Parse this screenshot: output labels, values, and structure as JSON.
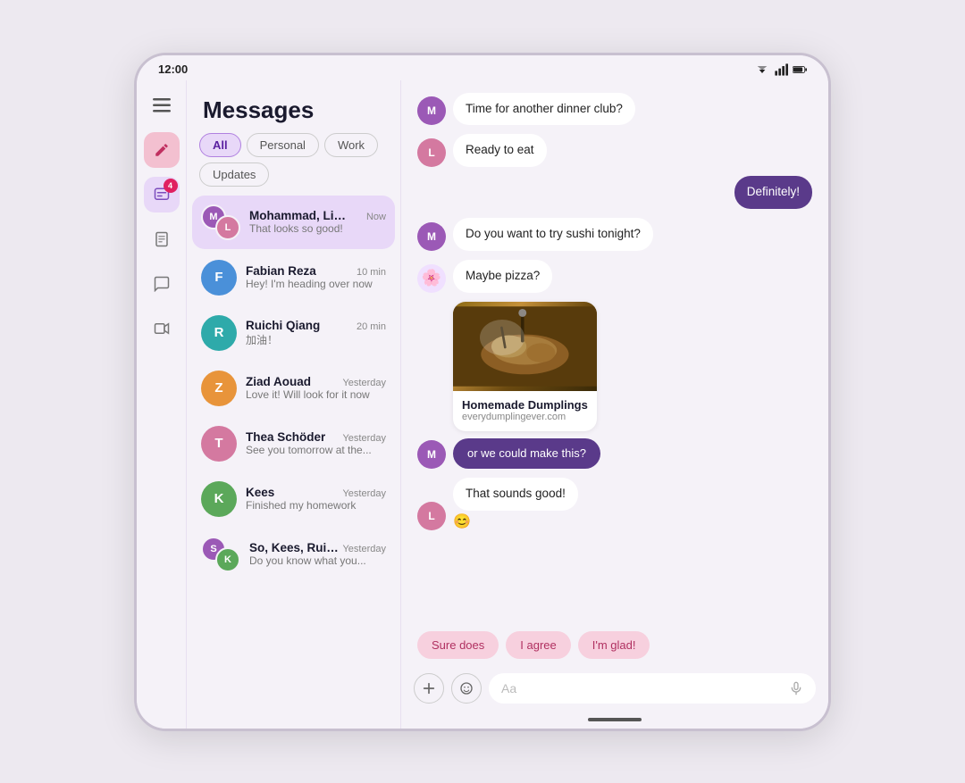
{
  "status_bar": {
    "time": "12:00"
  },
  "sidebar": {
    "compose_label": "✏",
    "messages_label": "📷",
    "notes_label": "📋",
    "chat_label": "💬",
    "video_label": "🎥",
    "badge_count": "4"
  },
  "messages": {
    "title": "Messages",
    "filters": [
      {
        "id": "all",
        "label": "All",
        "selected": true
      },
      {
        "id": "personal",
        "label": "Personal",
        "selected": false
      },
      {
        "id": "work",
        "label": "Work",
        "selected": false
      },
      {
        "id": "updates",
        "label": "Updates",
        "selected": false
      }
    ],
    "conversations": [
      {
        "id": "1",
        "name": "Mohammad, Lily, So",
        "time": "Now",
        "preview": "That looks so good!",
        "active": true,
        "avatar_type": "group"
      },
      {
        "id": "2",
        "name": "Fabian Reza",
        "time": "10 min",
        "preview": "Hey! I'm heading over now",
        "active": false,
        "avatar_type": "single",
        "avatar_color": "bg-blue"
      },
      {
        "id": "3",
        "name": "Ruichi Qiang",
        "time": "20 min",
        "preview": "加油！",
        "active": false,
        "avatar_type": "single",
        "avatar_color": "bg-teal"
      },
      {
        "id": "4",
        "name": "Ziad Aouad",
        "time": "Yesterday",
        "preview": "Love it! Will look for it now",
        "active": false,
        "avatar_type": "single",
        "avatar_color": "bg-orange"
      },
      {
        "id": "5",
        "name": "Thea Schöder",
        "time": "Yesterday",
        "preview": "See you tomorrow at the...",
        "active": false,
        "avatar_type": "single",
        "avatar_color": "bg-pink"
      },
      {
        "id": "6",
        "name": "Kees",
        "time": "Yesterday",
        "preview": "Finished my homework",
        "active": false,
        "avatar_type": "single",
        "avatar_color": "bg-green"
      },
      {
        "id": "7",
        "name": "So, Kees, Ruichi",
        "time": "Yesterday",
        "preview": "Do you know what you...",
        "active": false,
        "avatar_type": "group2"
      }
    ]
  },
  "chat": {
    "messages": [
      {
        "id": "1",
        "sender": "other1",
        "text": "Time for another dinner club?",
        "sent": false
      },
      {
        "id": "2",
        "sender": "other2",
        "text": "Ready to eat",
        "sent": false
      },
      {
        "id": "3",
        "sender": "me",
        "text": "Definitely!",
        "sent": true
      },
      {
        "id": "4",
        "sender": "other1",
        "text": "Do you want to try sushi tonight?",
        "sent": false
      },
      {
        "id": "5",
        "sender": "other3",
        "text": "Maybe pizza?",
        "sent": false
      },
      {
        "id": "6",
        "sender": "other1",
        "link_card": true,
        "card_title": "Homemade Dumplings",
        "card_url": "everydumplingever.com",
        "sent": false
      },
      {
        "id": "7",
        "sender": "me",
        "text": "or we could make this?",
        "sent": true,
        "is_pill": true
      },
      {
        "id": "8",
        "sender": "other2",
        "text": "That sounds good!",
        "sent": false,
        "emoji": "😊"
      }
    ],
    "quick_replies": [
      "Sure does",
      "I agree",
      "I'm glad!"
    ],
    "input_placeholder": "Aa"
  }
}
